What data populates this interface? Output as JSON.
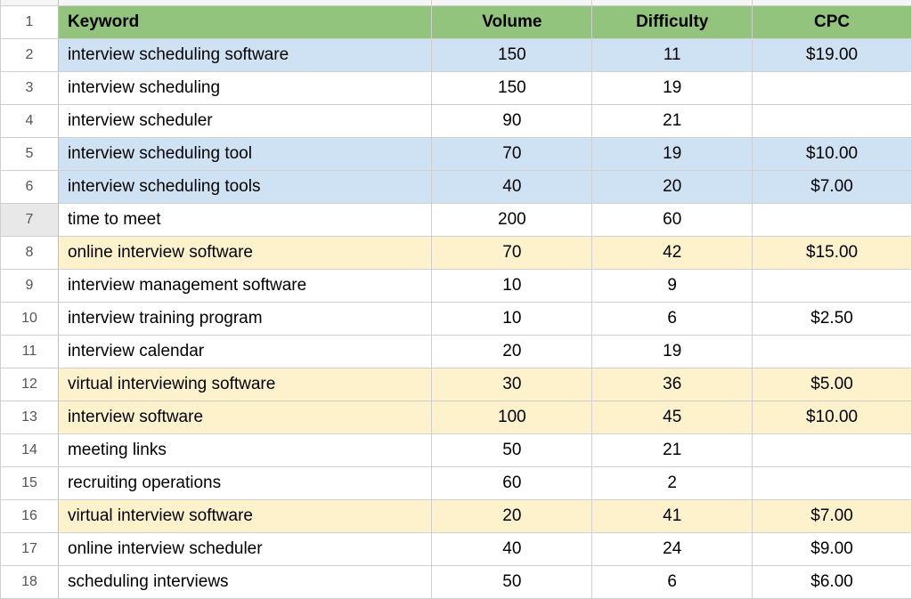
{
  "chart_data": {
    "type": "table",
    "columns": [
      "Keyword",
      "Volume",
      "Difficulty",
      "CPC"
    ],
    "rows": [
      {
        "num": "1",
        "keyword": "",
        "volume": "",
        "difficulty": "",
        "cpc": "",
        "bg": "header"
      },
      {
        "num": "2",
        "keyword": "interview scheduling software",
        "volume": "150",
        "difficulty": "11",
        "cpc": "$19.00",
        "bg": "blue"
      },
      {
        "num": "3",
        "keyword": "interview scheduling",
        "volume": "150",
        "difficulty": "19",
        "cpc": "",
        "bg": "white"
      },
      {
        "num": "4",
        "keyword": "interview scheduler",
        "volume": "90",
        "difficulty": "21",
        "cpc": "",
        "bg": "white"
      },
      {
        "num": "5",
        "keyword": "interview scheduling tool",
        "volume": "70",
        "difficulty": "19",
        "cpc": "$10.00",
        "bg": "blue"
      },
      {
        "num": "6",
        "keyword": "interview scheduling tools",
        "volume": "40",
        "difficulty": "20",
        "cpc": "$7.00",
        "bg": "blue"
      },
      {
        "num": "7",
        "keyword": "time to meet",
        "volume": "200",
        "difficulty": "60",
        "cpc": "",
        "bg": "white",
        "selected": true
      },
      {
        "num": "8",
        "keyword": "online interview software",
        "volume": "70",
        "difficulty": "42",
        "cpc": "$15.00",
        "bg": "yellow"
      },
      {
        "num": "9",
        "keyword": "interview management software",
        "volume": "10",
        "difficulty": "9",
        "cpc": "",
        "bg": "white"
      },
      {
        "num": "10",
        "keyword": "interview training program",
        "volume": "10",
        "difficulty": "6",
        "cpc": "$2.50",
        "bg": "white"
      },
      {
        "num": "11",
        "keyword": "interview calendar",
        "volume": "20",
        "difficulty": "19",
        "cpc": "",
        "bg": "white"
      },
      {
        "num": "12",
        "keyword": "virtual interviewing software",
        "volume": "30",
        "difficulty": "36",
        "cpc": "$5.00",
        "bg": "yellow"
      },
      {
        "num": "13",
        "keyword": "interview software",
        "volume": "100",
        "difficulty": "45",
        "cpc": "$10.00",
        "bg": "yellow"
      },
      {
        "num": "14",
        "keyword": "meeting links",
        "volume": "50",
        "difficulty": "21",
        "cpc": "",
        "bg": "white"
      },
      {
        "num": "15",
        "keyword": "recruiting operations",
        "volume": "60",
        "difficulty": "2",
        "cpc": "",
        "bg": "white"
      },
      {
        "num": "16",
        "keyword": "virtual interview software",
        "volume": "20",
        "difficulty": "41",
        "cpc": "$7.00",
        "bg": "yellow"
      },
      {
        "num": "17",
        "keyword": "online interview scheduler",
        "volume": "40",
        "difficulty": "24",
        "cpc": "$9.00",
        "bg": "white"
      },
      {
        "num": "18",
        "keyword": "scheduling interviews",
        "volume": "50",
        "difficulty": "6",
        "cpc": "$6.00",
        "bg": "white"
      }
    ]
  },
  "headers": {
    "keyword": "Keyword",
    "volume": "Volume",
    "difficulty": "Difficulty",
    "cpc": "CPC"
  }
}
